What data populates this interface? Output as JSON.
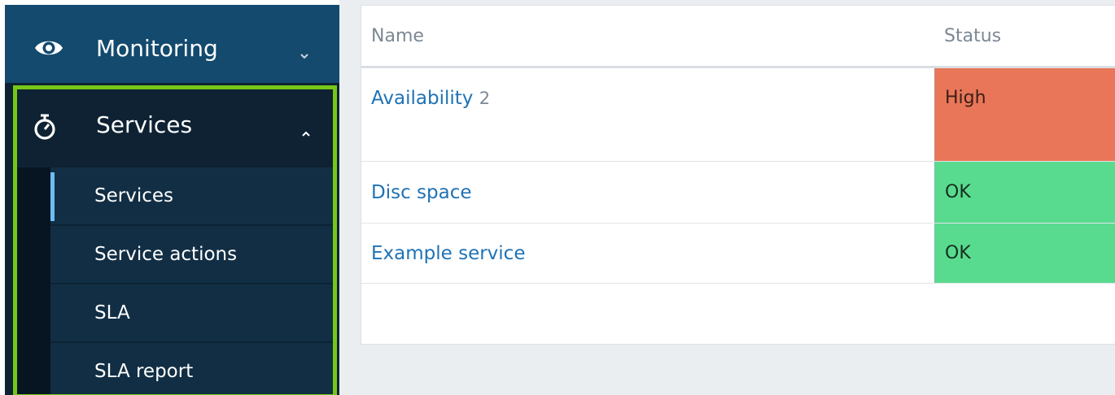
{
  "sidebar": {
    "monitoring": {
      "label": "Monitoring",
      "icon": "eye-icon",
      "chevron": "chevron-down-icon"
    },
    "services": {
      "label": "Services",
      "icon": "stopwatch-icon",
      "chevron": "chevron-up-icon",
      "highlight_color": "#76c718",
      "items": [
        {
          "label": "Services",
          "active": true
        },
        {
          "label": "Service actions",
          "active": false
        },
        {
          "label": "SLA",
          "active": false
        },
        {
          "label": "SLA report",
          "active": false
        }
      ]
    }
  },
  "table": {
    "columns": {
      "name": "Name",
      "status": "Status"
    },
    "rows": [
      {
        "name": "Availability",
        "count": "2",
        "status": "High",
        "status_color": "#e97659"
      },
      {
        "name": "Disc space",
        "count": "",
        "status": "OK",
        "status_color": "#59db8f"
      },
      {
        "name": "Example service",
        "count": "",
        "status": "OK",
        "status_color": "#59db8f"
      }
    ]
  },
  "colors": {
    "accent_link": "#1f72b5",
    "active_indicator": "#6bbef2",
    "sidebar_top": "#134a6e",
    "sidebar_dark": "#0e2233"
  }
}
